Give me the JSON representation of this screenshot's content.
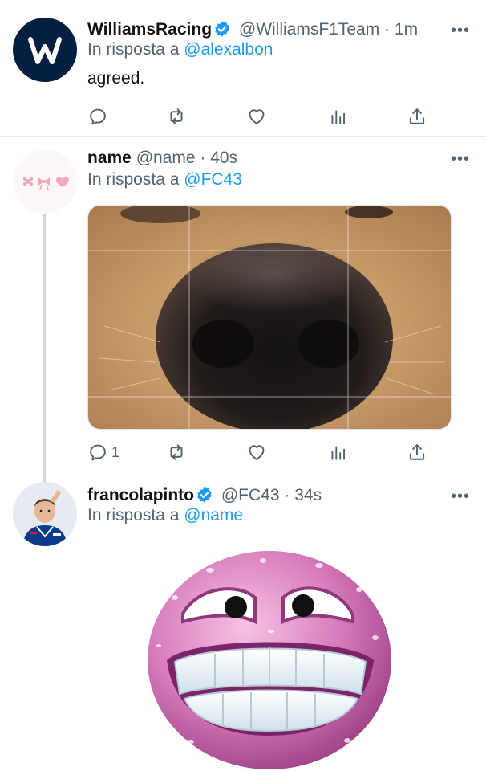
{
  "tweets": [
    {
      "display_name": "WilliamsRacing",
      "handle": "@WilliamsF1Team",
      "separator": "·",
      "time": "1m",
      "reply_prefix": "In risposta a",
      "reply_handle": "@alexalbon",
      "text": "agreed.",
      "verified": true,
      "reply_count": "",
      "avatar_icon": "williams-w-logo",
      "avatar_color": "#041e42"
    },
    {
      "display_name": "name",
      "handle": "@name",
      "separator": "·",
      "time": "40s",
      "reply_prefix": "In risposta a",
      "reply_handle": "@FC43",
      "text": "",
      "verified": false,
      "reply_count": "1",
      "avatar_icon": "bows-and-hearts-emoji",
      "media": "dog-nose-closeup-photo"
    },
    {
      "display_name": "francolapinto",
      "handle": "@FC43",
      "separator": "·",
      "time": "34s",
      "reply_prefix": "In risposta a",
      "reply_handle": "@name",
      "text": "",
      "verified": true,
      "avatar_icon": "driver-photo",
      "media": "pink-sweating-grin-emoji"
    }
  ],
  "more_glyph": "•••",
  "colors": {
    "link": "#1d9bf0",
    "verified": "#1d9bf0",
    "secondary_text": "#536471",
    "thread_line": "#cfd9de"
  }
}
